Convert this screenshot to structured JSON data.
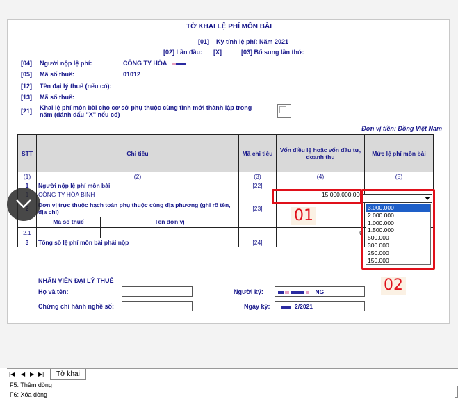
{
  "form": {
    "title": "TỜ KHAI LỆ PHÍ MÔN BÀI",
    "period_code": "[01]",
    "period_label": "Kỳ tính lệ phí: Năm 2021",
    "first_code": "[02] Lần đầu:",
    "first_value": "[X]",
    "supp_label": "[03] Bổ sung lần thứ:",
    "fields": [
      {
        "code": "[04]",
        "label": "Người nộp lệ phí:",
        "value": "CÔNG TY HÒA"
      },
      {
        "code": "[05]",
        "label": "Mã số thuế:",
        "value": "01012"
      },
      {
        "code": "[12]",
        "label": "Tên đại lý thuế (nếu có):",
        "value": ""
      },
      {
        "code": "[13]",
        "label": "Mã số thuế:",
        "value": ""
      }
    ],
    "dependent_code": "[21]",
    "dependent_label_1": "Khai lệ phí môn bài cho cơ sở phụ thuộc cùng tỉnh mới thành lập trong",
    "dependent_label_2": "năm (đánh dấu \"X\" nếu có)",
    "currency": "Đơn vị tiền: Đồng Việt Nam"
  },
  "table": {
    "headers": [
      "STT",
      "Chỉ tiêu",
      "Mã chỉ tiêu",
      "Vốn điều lệ hoặc vốn đầu tư, doanh thu",
      "Mức lệ phí môn bài"
    ],
    "index_row": [
      "(1)",
      "(2)",
      "(3)",
      "(4)",
      "(5)"
    ],
    "row1": {
      "stt": "1",
      "label": "Người nộp lệ phí môn bài",
      "code": "[22]"
    },
    "row1_1": {
      "stt": "1",
      "label": "CÔNG TY HÒA BÌNH",
      "capital": "15.000.000.000"
    },
    "row2": {
      "stt": "2",
      "label": "Đơn vị trực thuộc hạch toán phụ thuộc cùng địa phương (ghi rõ tên, địa chỉ)",
      "code": "[23]"
    },
    "row2_sub": {
      "tax_code": "Mã số thuế",
      "unit_name": "Tên đơn vị"
    },
    "row2_1": {
      "stt": "2.1",
      "value": "0"
    },
    "row3": {
      "stt": "3",
      "label": "Tổng số lệ phí môn bài phải nộp",
      "code": "[24]"
    }
  },
  "dropdown": {
    "options": [
      "3.000.000",
      "2.000.000",
      "1.000.000",
      "1.500.000",
      "500.000",
      "300.000",
      "250.000",
      "150.000"
    ],
    "selected_index": 0
  },
  "callouts": {
    "first": "01",
    "second": "02"
  },
  "agent": {
    "heading": "NHÂN VIÊN ĐẠI LÝ THUẾ",
    "name_label": "Họ và tên:",
    "cert_label": "Chứng chỉ hành nghề số:",
    "signer_label": "Người ký:",
    "signer_value": "NG",
    "date_label": "Ngày ký:",
    "date_value": "2/2021"
  },
  "tabs": {
    "sheet": "Tờ khai"
  },
  "status": {
    "line1": "F5: Thêm dòng",
    "line2": "F6: Xóa dòng"
  },
  "colors": {
    "accent_red": "#e0101a",
    "text_blue": "#1a1a8c",
    "selection": "#1e5fc8"
  }
}
